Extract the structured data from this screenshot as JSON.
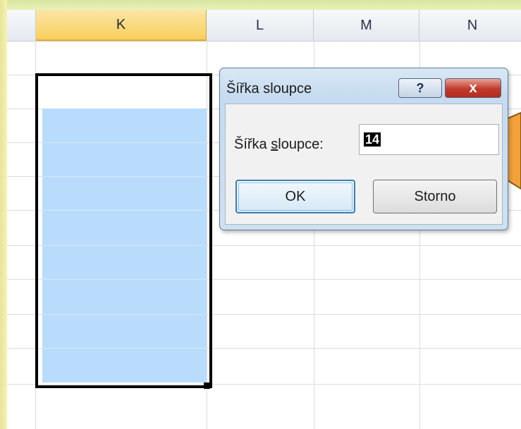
{
  "columns": [
    {
      "label": "K",
      "selected": true
    },
    {
      "label": "L",
      "selected": false
    },
    {
      "label": "M",
      "selected": false
    },
    {
      "label": "N",
      "selected": false
    }
  ],
  "dialog": {
    "title": "Šířka sloupce",
    "help_label": "?",
    "close_label": "x",
    "field_label_prefix": "Šířka ",
    "field_label_hotkey": "s",
    "field_label_suffix": "loupce:",
    "input_value": "14",
    "ok_label": "OK",
    "cancel_label": "Storno"
  },
  "colors": {
    "selection_fill": "#b9dcfd",
    "selected_header": "#f7cf5c",
    "callout": "#f3a13a",
    "dialog_frame": "#c6dbef",
    "close_button": "#c0392b"
  }
}
